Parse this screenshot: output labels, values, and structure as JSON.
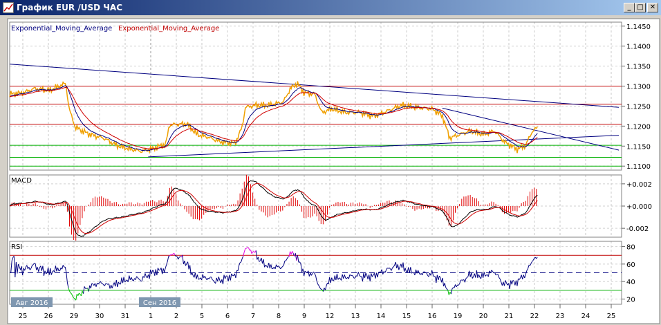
{
  "window": {
    "title": "График EUR /USD  ЧАС",
    "minimize": "_",
    "maximize": "□",
    "close": "✕"
  },
  "legend": {
    "ema1": "Exponential_Moving_Average",
    "ema2": "Exponential_Moving_Average"
  },
  "colors": {
    "price": "#f0a000",
    "ema1": "#000080",
    "ema2": "#d00000",
    "resistance": "#c00000",
    "support": "#00b000",
    "trend": "#000080",
    "rsi": "#000080",
    "overbought": "#e000e0",
    "oversold": "#00c000"
  },
  "chart_data": [
    {
      "type": "line",
      "title": "EUR/USD H1",
      "ylim": [
        1.109,
        1.146
      ],
      "yticks": [
        "1.1450",
        "1.1400",
        "1.1350",
        "1.1300",
        "1.1250",
        "1.1200",
        "1.1150",
        "1.1100"
      ],
      "ytick_values": [
        1.145,
        1.14,
        1.135,
        1.13,
        1.125,
        1.12,
        1.115,
        1.11
      ],
      "price_points": [
        [
          -0.51,
          1.128
        ],
        [
          0,
          1.1283
        ],
        [
          0.46,
          1.1294
        ],
        [
          1.03,
          1.1289
        ],
        [
          1.68,
          1.1307
        ],
        [
          1.81,
          1.1243
        ],
        [
          2.05,
          1.1197
        ],
        [
          2.62,
          1.1179
        ],
        [
          3.16,
          1.117
        ],
        [
          3.7,
          1.1151
        ],
        [
          4.24,
          1.1142
        ],
        [
          4.65,
          1.1137
        ],
        [
          4.97,
          1.1142
        ],
        [
          5.59,
          1.1155
        ],
        [
          5.73,
          1.1203
        ],
        [
          6.41,
          1.1206
        ],
        [
          6.81,
          1.1179
        ],
        [
          7.22,
          1.1173
        ],
        [
          7.76,
          1.116
        ],
        [
          8.3,
          1.1157
        ],
        [
          8.57,
          1.1197
        ],
        [
          8.7,
          1.1247
        ],
        [
          9.11,
          1.1252
        ],
        [
          9.65,
          1.1252
        ],
        [
          10.19,
          1.1261
        ],
        [
          10.46,
          1.1294
        ],
        [
          10.73,
          1.1307
        ],
        [
          11.0,
          1.1283
        ],
        [
          11.41,
          1.128
        ],
        [
          11.68,
          1.1234
        ],
        [
          12.08,
          1.1243
        ],
        [
          12.62,
          1.1234
        ],
        [
          13.16,
          1.1234
        ],
        [
          13.7,
          1.1225
        ],
        [
          14.11,
          1.1234
        ],
        [
          14.78,
          1.1252
        ],
        [
          15.32,
          1.1247
        ],
        [
          16.0,
          1.1243
        ],
        [
          16.41,
          1.1225
        ],
        [
          16.68,
          1.117
        ],
        [
          17.08,
          1.1179
        ],
        [
          17.49,
          1.1188
        ],
        [
          18.03,
          1.1179
        ],
        [
          18.43,
          1.1188
        ],
        [
          18.84,
          1.116
        ],
        [
          19.32,
          1.1142
        ],
        [
          19.65,
          1.1151
        ],
        [
          19.92,
          1.1188
        ],
        [
          20.14,
          1.1197
        ]
      ],
      "horizontal_lines": {
        "resistance": [
          1.13,
          1.1255,
          1.1205
        ],
        "support": [
          1.1152,
          1.1122,
          1.11
        ]
      },
      "trend_lines": [
        [
          [
            -0.51,
            1.1355
          ],
          [
            23.3,
            1.1247
          ]
        ],
        [
          [
            4.9,
            1.1123
          ],
          [
            23.3,
            1.1177
          ]
        ],
        [
          [
            16.4,
            1.1245
          ],
          [
            23.3,
            1.114
          ]
        ]
      ],
      "legend": [
        "Exponential_Moving_Average",
        "Exponential_Moving_Average"
      ]
    },
    {
      "type": "bar",
      "title": "MACD",
      "ylim": [
        -0.0028,
        0.0028
      ],
      "yticks": [
        "+0.002",
        "+0.000",
        "-0.002"
      ],
      "ytick_values": [
        0.002,
        0,
        -0.002
      ]
    },
    {
      "type": "line",
      "title": "RSI",
      "ylim": [
        14,
        86
      ],
      "yticks": [
        "80",
        "60",
        "40",
        "20"
      ],
      "ytick_values": [
        80,
        60,
        40,
        20
      ],
      "levels": {
        "upper": 70,
        "middle": 50,
        "lower": 30
      }
    }
  ],
  "x_axis": {
    "labels": [
      "25",
      "26",
      "29",
      "30",
      "31",
      "1",
      "2",
      "5",
      "6",
      "7",
      "8",
      "9",
      "12",
      "13",
      "14",
      "15",
      "16",
      "19",
      "20",
      "21",
      "22",
      "23",
      "24",
      "25"
    ],
    "months": [
      {
        "label": "Авг 2016",
        "index": 0
      },
      {
        "label": "Сен 2016",
        "index": 5
      }
    ]
  }
}
